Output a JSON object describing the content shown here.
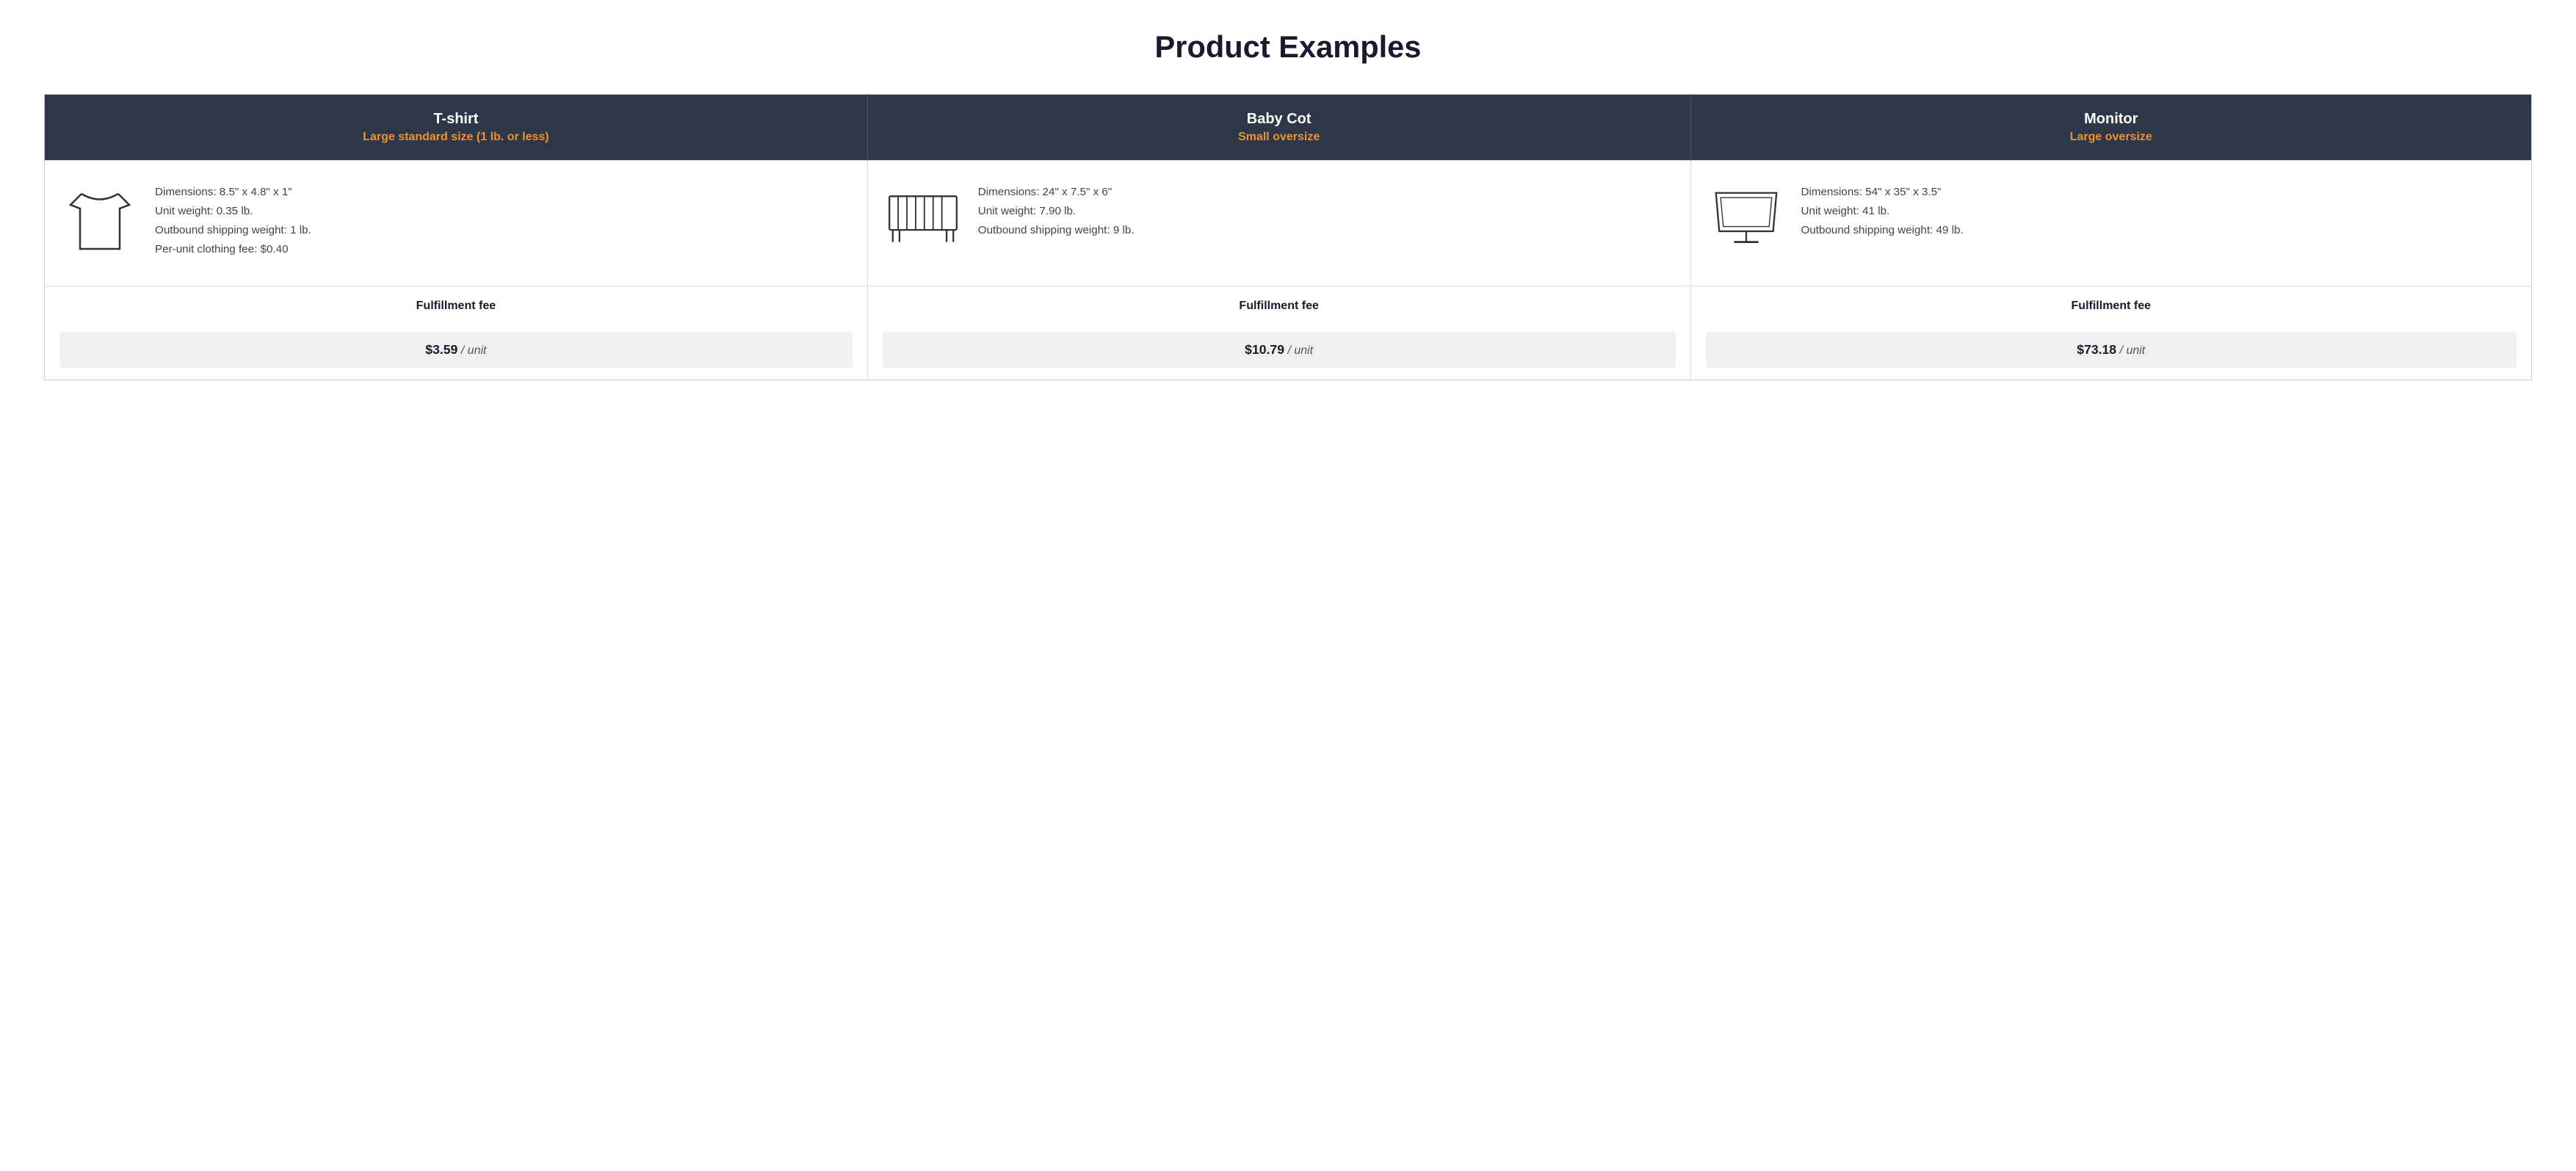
{
  "page": {
    "title": "Product Examples"
  },
  "columns": [
    {
      "id": "tshirt",
      "name": "T-shirt",
      "category": "Large standard size (1 lb. or less)",
      "dimensions": "Dimensions: 8.5\" x 4.8\" x 1\"",
      "unit_weight": "Unit weight: 0.35 lb.",
      "shipping_weight": "Outbound shipping weight: 1 lb.",
      "extra": "Per-unit clothing fee: $0.40",
      "fulfillment_label": "Fulfillment fee",
      "fee_amount": "$3.59",
      "fee_unit": "/ unit",
      "icon": "tshirt"
    },
    {
      "id": "babycot",
      "name": "Baby Cot",
      "category": "Small oversize",
      "dimensions": "Dimensions: 24\" x 7.5\" x 6\"",
      "unit_weight": "Unit weight: 7.90 lb.",
      "shipping_weight": "Outbound shipping weight: 9 lb.",
      "extra": "",
      "fulfillment_label": "Fulfillment fee",
      "fee_amount": "$10.79",
      "fee_unit": "/ unit",
      "icon": "cot"
    },
    {
      "id": "monitor",
      "name": "Monitor",
      "category": "Large oversize",
      "dimensions": "Dimensions: 54\" x 35\" x 3.5\"",
      "unit_weight": "Unit weight: 41 lb.",
      "shipping_weight": "Outbound shipping weight: 49 lb.",
      "extra": "",
      "fulfillment_label": "Fulfillment fee",
      "fee_amount": "$73.18",
      "fee_unit": "/ unit",
      "icon": "monitor"
    }
  ]
}
